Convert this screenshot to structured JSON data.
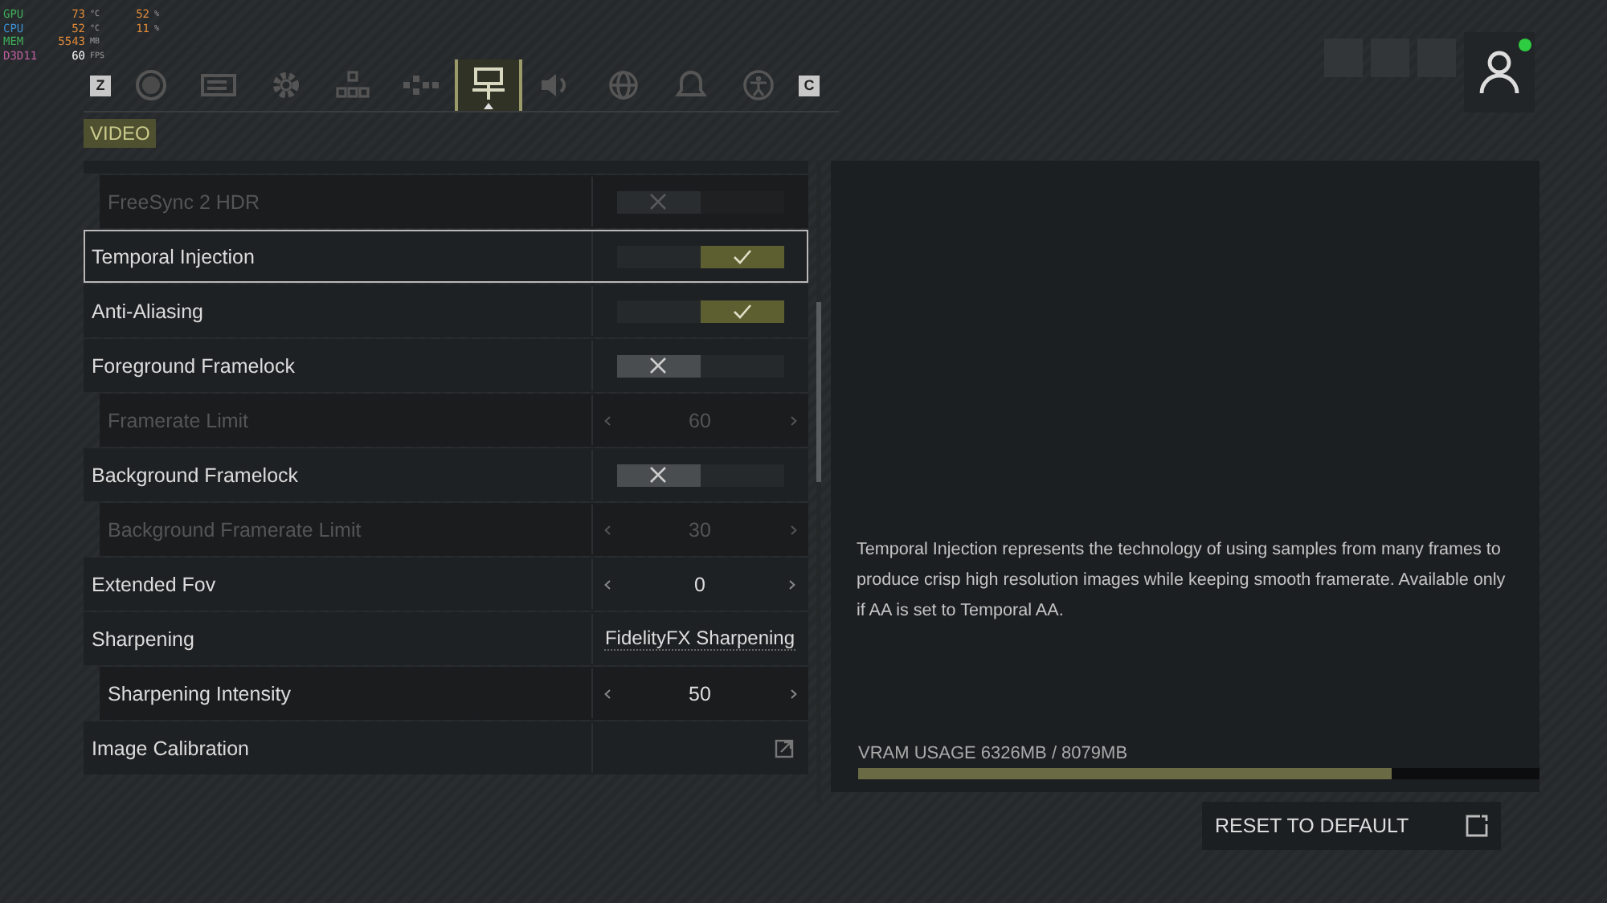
{
  "hud": [
    {
      "label": "GPU",
      "kind": "gpu",
      "value": "73",
      "unit": "°C",
      "value2": "52",
      "unit2": "%"
    },
    {
      "label": "CPU",
      "kind": "cpu",
      "value": "52",
      "unit": "°C",
      "value2": "11",
      "unit2": "%"
    },
    {
      "label": "MEM",
      "kind": "mem",
      "value": "5543",
      "unit": "MB"
    },
    {
      "label": "D3D11",
      "kind": "api",
      "value": "60",
      "unit": "FPS"
    }
  ],
  "tabs": {
    "prev_key": "Z",
    "next_key": "C",
    "items": [
      {
        "kind": "disc",
        "selected": false
      },
      {
        "kind": "card",
        "selected": false
      },
      {
        "kind": "gear",
        "selected": false
      },
      {
        "kind": "network",
        "selected": false
      },
      {
        "kind": "gamepad",
        "selected": false
      },
      {
        "kind": "video",
        "selected": true
      },
      {
        "kind": "speaker",
        "selected": false
      },
      {
        "kind": "globe",
        "selected": false
      },
      {
        "kind": "bell",
        "selected": false
      },
      {
        "kind": "access",
        "selected": false
      }
    ]
  },
  "section": "VIDEO",
  "settings": [
    {
      "label": "FreeSync 2 HDR",
      "kind": "toggle",
      "checked": false,
      "disabled": true,
      "sub": true,
      "selected": false
    },
    {
      "label": "Temporal Injection",
      "kind": "toggle",
      "checked": true,
      "disabled": false,
      "selected": true
    },
    {
      "label": "Anti-Aliasing",
      "kind": "toggle",
      "checked": true,
      "disabled": false,
      "selected": false
    },
    {
      "label": "Foreground Framelock",
      "kind": "toggle",
      "checked": false,
      "disabled": false,
      "selected": false,
      "children": [
        {
          "label": "Framerate Limit",
          "kind": "stepper",
          "value": "60",
          "disabled": true,
          "selected": false
        }
      ]
    },
    {
      "label": "Background Framelock",
      "kind": "toggle",
      "checked": false,
      "disabled": false,
      "selected": false,
      "children": [
        {
          "label": "Background Framerate Limit",
          "kind": "stepper",
          "value": "30",
          "disabled": true,
          "selected": false
        }
      ]
    },
    {
      "label": "Extended Fov",
      "kind": "stepper",
      "value": "0",
      "disabled": false,
      "selected": false
    },
    {
      "label": "Sharpening",
      "kind": "dropdown",
      "value": "FidelityFX Sharpening",
      "disabled": false,
      "selected": false,
      "children": [
        {
          "label": "Sharpening Intensity",
          "kind": "stepper",
          "value": "50",
          "disabled": false,
          "selected": false
        }
      ]
    },
    {
      "label": "Image Calibration",
      "kind": "link",
      "disabled": false,
      "selected": false
    }
  ],
  "description": "Temporal Injection represents the technology of using samples from many frames to produce crisp high resolution images while keeping smooth framerate. Available only if AA is set to Temporal AA.",
  "vram": {
    "label": "VRAM USAGE",
    "reading": "6326MB / 8079MB",
    "level": 0.783
  },
  "reset_button": "RESET TO DEFAULT",
  "profile": {
    "online": true
  }
}
